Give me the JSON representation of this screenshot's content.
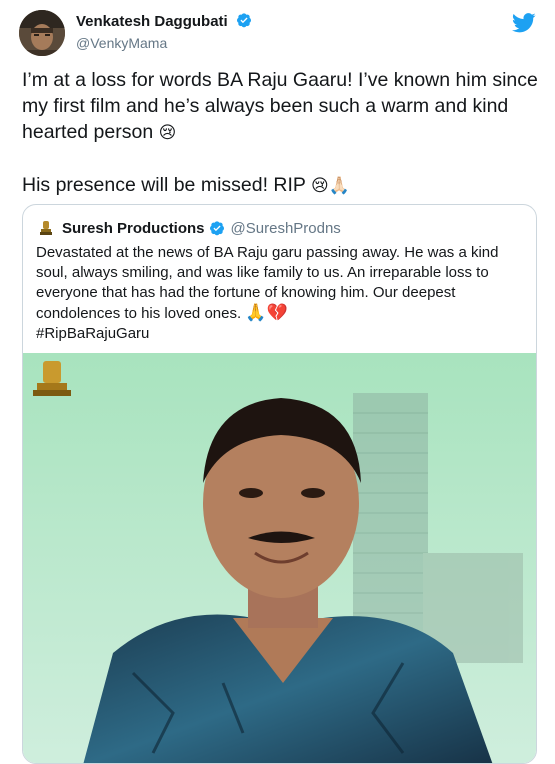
{
  "tweet": {
    "author": {
      "display_name": "Venkatesh Daggubati",
      "handle": "@VenkyMama",
      "verified": true
    },
    "text_line1": "I’m at a loss for words BA Raju Gaaru! I’ve known him since my first film and he’s always been such a warm and kind hearted person ",
    "emoji_crying": "😢",
    "text_line2": "His presence will be missed! RIP ",
    "emoji_pray": "🙏🏻",
    "brand_icon": "twitter-bird-icon",
    "colors": {
      "brand": "#1da1f2",
      "verified": "#1da1f2",
      "text": "#14171a",
      "secondary": "#657786",
      "border": "#ccd6dd"
    }
  },
  "quote": {
    "author": {
      "display_name": "Suresh Productions",
      "handle": "@SureshProdns",
      "verified": true
    },
    "text": "Devastated at the news of BA Raju garu passing away. He was a kind soul, always smiling, and was like family to us. An irreparable loss to everyone that has had the fortune of knowing him. Our deepest condolences to his loved ones. ",
    "emoji": "🙏💔",
    "hashtag": "#RipBaRajuGaru",
    "image_icon": "portrait-photo"
  }
}
